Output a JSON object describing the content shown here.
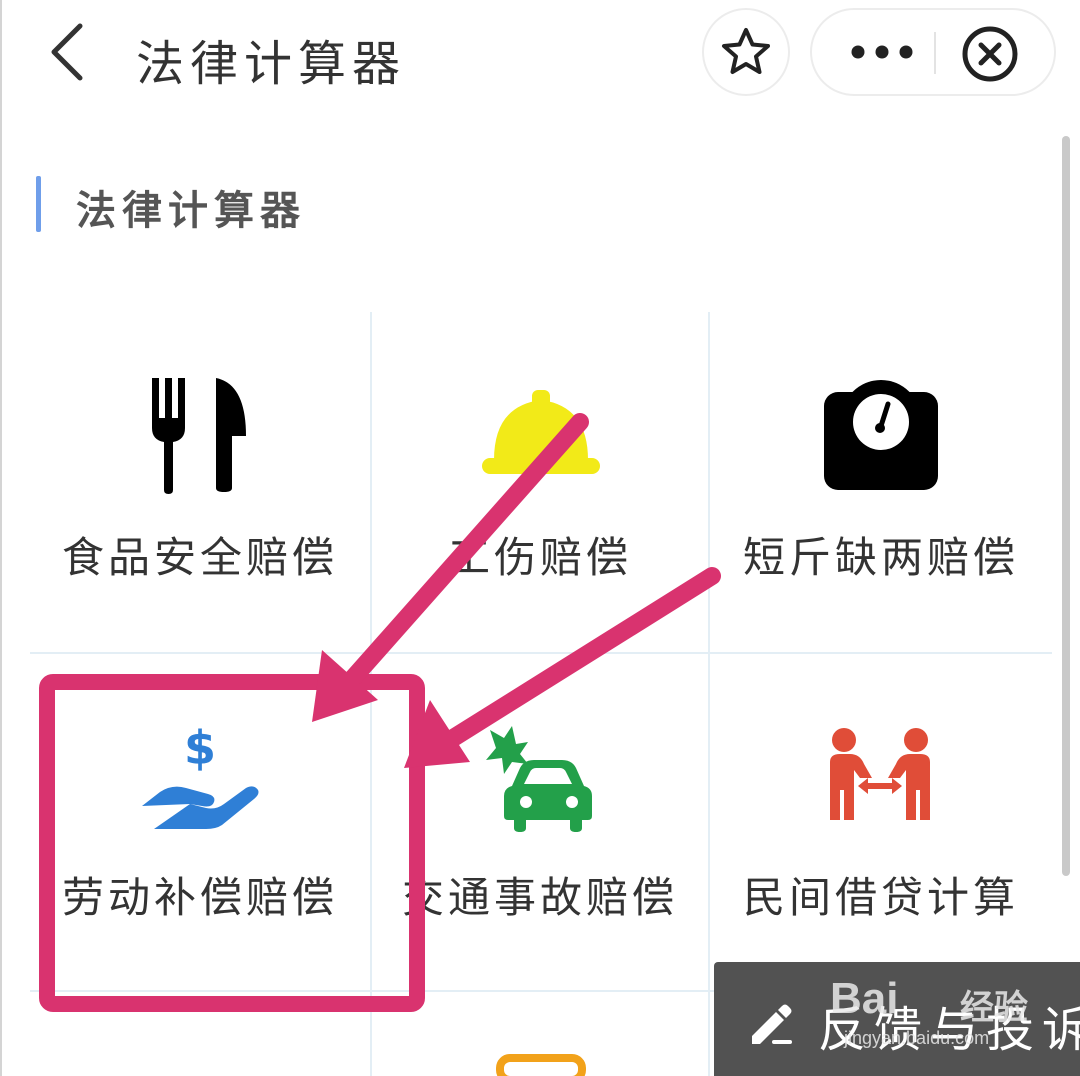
{
  "header": {
    "title": "法律计算器",
    "back_icon": "chevron-left-icon",
    "star_icon": "star-icon",
    "more_icon": "more-dots-icon",
    "close_icon": "close-circle-icon"
  },
  "section": {
    "title": "法律计算器",
    "marker_color": "#6f9eea"
  },
  "calculators": [
    {
      "label": "食品安全赔偿",
      "icon": "fork-knife-icon",
      "color": "#000000"
    },
    {
      "label": "工伤赔偿",
      "icon": "hard-hat-icon",
      "color": "#f2ea18"
    },
    {
      "label": "短斤缺两赔偿",
      "icon": "scale-icon",
      "color": "#000000"
    },
    {
      "label": "劳动补偿赔偿",
      "icon": "hand-dollar-icon",
      "color": "#2f7fd6"
    },
    {
      "label": "交通事故赔偿",
      "icon": "car-crash-icon",
      "color": "#23a04a"
    },
    {
      "label": "民间借贷计算",
      "icon": "people-exchange-icon",
      "color": "#e04d38"
    }
  ],
  "feedback": {
    "label": "反馈与投诉",
    "icon": "pencil-icon"
  },
  "watermark": {
    "brand": "Bai",
    "product": "经验",
    "url": "jingyan.baidu.com"
  },
  "annotation": {
    "color": "#d9336f"
  }
}
